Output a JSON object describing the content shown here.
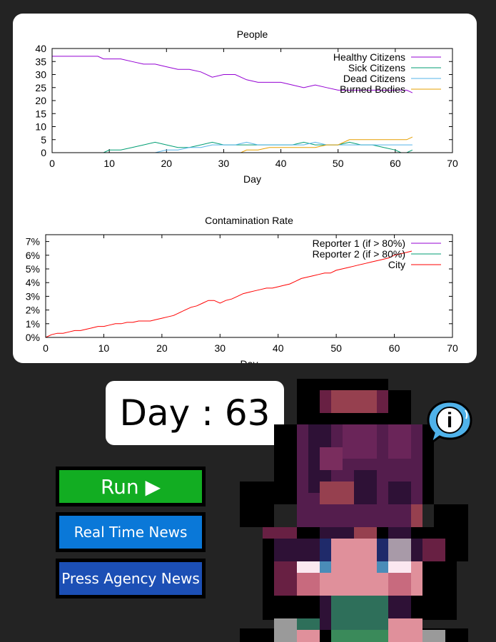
{
  "day": {
    "text": "Day : 63"
  },
  "buttons": {
    "run": "Run ▶",
    "realtime": "Real Time News",
    "press": "Press Agency News"
  },
  "info_icon": {
    "glyph": "i",
    "name": "info-bubble-icon"
  },
  "chart_data": [
    {
      "type": "line",
      "title": "People",
      "xlabel": "Day",
      "ylabel": "",
      "xlim": [
        0,
        70
      ],
      "ylim": [
        0,
        40
      ],
      "xticks": [
        "0",
        "10",
        "20",
        "30",
        "40",
        "50",
        "60",
        "70"
      ],
      "yticks": [
        "0",
        "5",
        "10",
        "15",
        "20",
        "25",
        "30",
        "35",
        "40"
      ],
      "legend_position": "top-right",
      "series": [
        {
          "name": "Healthy Citizens",
          "color": "#9400d3",
          "x": [
            0,
            8,
            9,
            12,
            14,
            16,
            18,
            20,
            22,
            24,
            26,
            28,
            30,
            32,
            34,
            36,
            38,
            40,
            42,
            44,
            46,
            48,
            50,
            52,
            54,
            56,
            58,
            60,
            62,
            63
          ],
          "y": [
            37,
            37,
            36,
            36,
            35,
            34,
            34,
            33,
            32,
            32,
            31,
            29,
            30,
            30,
            28,
            27,
            27,
            27,
            26,
            25,
            26,
            25,
            24,
            24,
            24,
            24,
            24,
            24,
            24,
            23
          ]
        },
        {
          "name": "Sick Citizens",
          "color": "#009e73",
          "x": [
            0,
            9,
            10,
            12,
            14,
            16,
            18,
            20,
            22,
            24,
            26,
            28,
            30,
            32,
            34,
            36,
            38,
            40,
            42,
            44,
            46,
            48,
            50,
            52,
            54,
            56,
            58,
            60,
            61,
            62,
            63
          ],
          "y": [
            0,
            0,
            1,
            1,
            2,
            3,
            4,
            3,
            2,
            2,
            3,
            4,
            3,
            3,
            3,
            3,
            3,
            3,
            3,
            4,
            3,
            3,
            3,
            4,
            3,
            3,
            2,
            1,
            0,
            0,
            1
          ]
        },
        {
          "name": "Dead Citizens",
          "color": "#56b4e9",
          "x": [
            0,
            18,
            20,
            22,
            24,
            26,
            28,
            30,
            32,
            34,
            36,
            38,
            40,
            42,
            44,
            46,
            48,
            50,
            52,
            54,
            56,
            58,
            60,
            62,
            63
          ],
          "y": [
            0,
            0,
            1,
            1,
            2,
            2,
            3,
            3,
            3,
            4,
            3,
            3,
            3,
            3,
            3,
            4,
            3,
            3,
            3,
            3,
            3,
            3,
            3,
            3,
            3
          ]
        },
        {
          "name": "Burned Bodies",
          "color": "#e69f00",
          "x": [
            0,
            33,
            34,
            36,
            38,
            40,
            42,
            44,
            46,
            48,
            50,
            52,
            54,
            56,
            58,
            60,
            62,
            63
          ],
          "y": [
            0,
            0,
            1,
            1,
            2,
            2,
            2,
            2,
            2,
            3,
            3,
            5,
            5,
            5,
            5,
            5,
            5,
            6
          ]
        }
      ]
    },
    {
      "type": "line",
      "title": "Contamination Rate",
      "xlabel": "Day",
      "ylabel": "",
      "xlim": [
        0,
        70
      ],
      "ylim": [
        0,
        7.5
      ],
      "xticks": [
        "0",
        "10",
        "20",
        "30",
        "40",
        "50",
        "60",
        "70"
      ],
      "yticks": [
        "0%",
        "1%",
        "2%",
        "3%",
        "4%",
        "5%",
        "6%",
        "7%"
      ],
      "legend_position": "top-right",
      "series": [
        {
          "name": "Reporter 1 (if > 80%)",
          "color": "#9400d3",
          "x": [],
          "y": []
        },
        {
          "name": "Reporter 2 (if > 80%)",
          "color": "#009e73",
          "x": [],
          "y": []
        },
        {
          "name": "City",
          "color": "#ff0000",
          "x": [
            0,
            1,
            2,
            3,
            4,
            5,
            6,
            7,
            8,
            9,
            10,
            11,
            12,
            13,
            14,
            15,
            16,
            17,
            18,
            19,
            20,
            21,
            22,
            23,
            24,
            25,
            26,
            27,
            28,
            29,
            30,
            31,
            32,
            33,
            34,
            35,
            36,
            37,
            38,
            39,
            40,
            41,
            42,
            43,
            44,
            45,
            46,
            47,
            48,
            49,
            50,
            51,
            52,
            53,
            54,
            55,
            56,
            57,
            58,
            59,
            60,
            61,
            62,
            63
          ],
          "y": [
            0,
            0.2,
            0.3,
            0.3,
            0.4,
            0.5,
            0.5,
            0.6,
            0.7,
            0.8,
            0.8,
            0.9,
            1.0,
            1.0,
            1.1,
            1.1,
            1.2,
            1.2,
            1.2,
            1.3,
            1.4,
            1.5,
            1.6,
            1.8,
            2.0,
            2.2,
            2.3,
            2.5,
            2.7,
            2.7,
            2.5,
            2.7,
            2.8,
            3.0,
            3.2,
            3.3,
            3.4,
            3.5,
            3.6,
            3.6,
            3.7,
            3.8,
            3.9,
            4.1,
            4.3,
            4.4,
            4.5,
            4.6,
            4.7,
            4.7,
            4.9,
            5.0,
            5.1,
            5.2,
            5.3,
            5.4,
            5.5,
            5.6,
            5.7,
            5.8,
            6.0,
            6.1,
            6.2,
            6.3
          ]
        }
      ]
    }
  ]
}
